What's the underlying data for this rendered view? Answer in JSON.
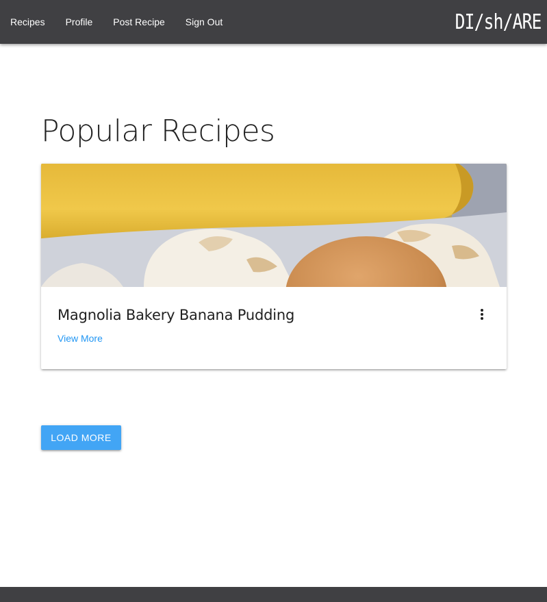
{
  "nav": {
    "links": [
      "Recipes",
      "Profile",
      "Post Recipe",
      "Sign Out"
    ],
    "brand": "DI/sh/ARE",
    "background": "#404043"
  },
  "main": {
    "title": "Popular Recipes",
    "cards": [
      {
        "title": "Magnolia Bakery Banana Pudding",
        "link_label": "View More",
        "menu_icon": "more-vert-icon",
        "image": "banana-pudding-photo"
      }
    ],
    "load_more_label": "LOAD MORE"
  },
  "colors": {
    "accent": "#2196f3",
    "button": "#42a5f5",
    "text": "#212121",
    "footer": "#404043"
  }
}
